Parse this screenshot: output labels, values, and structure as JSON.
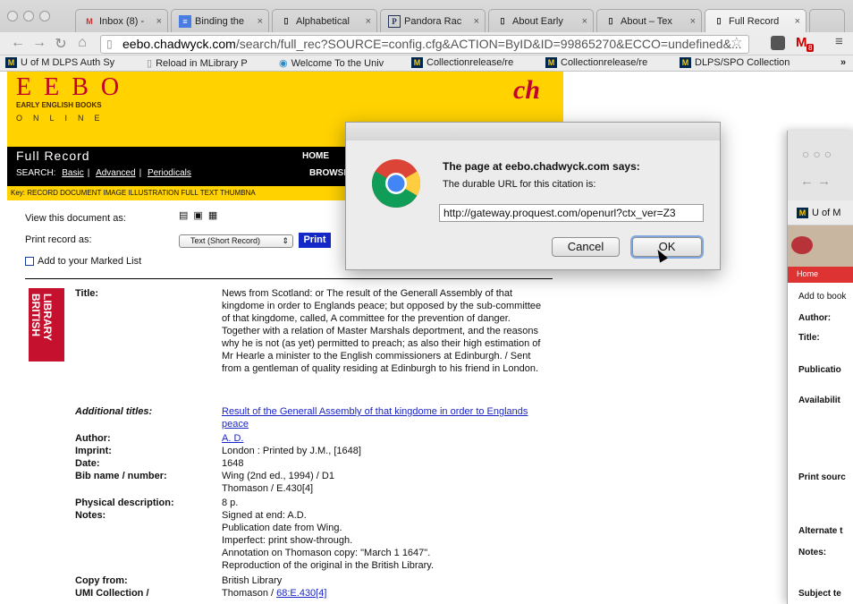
{
  "browser": {
    "tabs": [
      {
        "label": "Inbox (8) -",
        "icon": "M"
      },
      {
        "label": "Binding the",
        "icon": "≡"
      },
      {
        "label": "Alphabetical",
        "icon": ""
      },
      {
        "label": "Pandora Rac",
        "icon": "P"
      },
      {
        "label": "About Early",
        "icon": ""
      },
      {
        "label": "About – Tex",
        "icon": ""
      },
      {
        "label": "Full Record",
        "icon": ""
      }
    ],
    "url_domain": "eebo.chadwyck.com",
    "url_rest": "/search/full_rec?SOURCE=config.cfg&ACTION=ByID&ID=99865270&ECCO=undefined&...",
    "mail_badge": "8",
    "bookmarks": [
      {
        "label": "U of M DLPS Auth Sy",
        "icon": "M"
      },
      {
        "label": "Reload in MLibrary P",
        "icon": "doc"
      },
      {
        "label": "Welcome To the Univ",
        "icon": "globe"
      },
      {
        "label": "Collectionrelease/re",
        "icon": "M"
      },
      {
        "label": "Collectionrelease/re",
        "icon": "M"
      },
      {
        "label": "DLPS/SPO Collection",
        "icon": "M"
      }
    ]
  },
  "eebo": {
    "logo": "EEBO",
    "subtitle_line1": "EARLY ENGLISH BOOKS",
    "subtitle_line2": "ONLINE",
    "section_title": "Full Record",
    "nav_home": "HOME",
    "search_label": "SEARCH:",
    "search_basic": "Basic",
    "search_advanced": "Advanced",
    "search_periodicals": "Periodicals",
    "browse_label": "BROWSE:",
    "key_text": "Key: RECORD  DOCUMENT IMAGE  ILLUSTRATION  FULL TEXT  THUMBNA"
  },
  "record": {
    "view_as": "View this document as:",
    "print_as": "Print record as:",
    "print_option": "Text (Short Record)",
    "print_button": "Print",
    "marked_list": "Add to your Marked List",
    "fields": [
      {
        "label": "Title:",
        "value": "News from Scotland: or The result of the Generall Assembly of that kingdome in order to Englands peace; but opposed by the sub-committee of that kingdome, called, A committee for the prevention of danger. Together with a relation of Master Marshals deportment, and the reasons why he is not (as yet) permitted to preach; as also their high estimation of Mr Hearle a minister to the English commissioners at Edinburgh. / Sent from a gentleman of quality residing at Edinburgh to his friend in London."
      },
      {
        "label": "Additional titles:",
        "value": "Result of the Generall Assembly of that kingdome in order to Englands peace"
      },
      {
        "label": "Author:",
        "value": "A. D."
      },
      {
        "label": "Imprint:",
        "value": "London : Printed by J.M., [1648]"
      },
      {
        "label": "Date:",
        "value": "1648"
      },
      {
        "label": "Bib name / number:",
        "value1": "Wing (2nd ed., 1994) / D1",
        "value2": "Thomason / E.430[4]"
      },
      {
        "label": "Physical description:",
        "value": "8 p."
      },
      {
        "label": "Notes:",
        "lines": [
          "Signed at end: A.D.",
          "Publication date from Wing.",
          "Imperfect: print show-through.",
          "Annotation on Thomason copy: \"March 1 1647\".",
          "Reproduction of the original in the British Library."
        ]
      },
      {
        "label": "Copy from:",
        "value": "British Library"
      },
      {
        "label": "UMI Collection /",
        "value": "Thomason / ",
        "link": "68:E.430[4]"
      }
    ]
  },
  "dialog": {
    "title": "The page at eebo.chadwyck.com says:",
    "message": "The durable URL for this citation is:",
    "url": "http://gateway.proquest.com/openurl?ctx_ver=Z3",
    "cancel": "Cancel",
    "ok": "OK"
  },
  "second_window": {
    "bookmark": "U of M",
    "home": "Home",
    "add": "Add to book",
    "labels": [
      "Author:",
      "Title:",
      "Publicatio",
      "Availabilit",
      "Print sourc",
      "Alternate t",
      "Notes:",
      "Subject te"
    ]
  }
}
